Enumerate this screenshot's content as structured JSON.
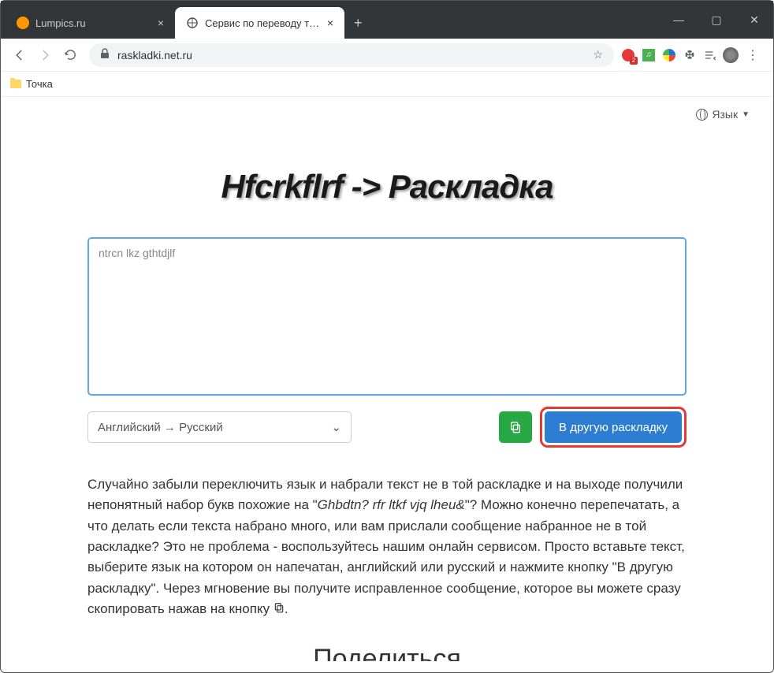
{
  "window": {
    "tabs": [
      {
        "title": "Lumpics.ru"
      },
      {
        "title": "Сервис по переводу текста в др"
      }
    ]
  },
  "toolbar": {
    "url": "raskladki.net.ru"
  },
  "bookmarks": {
    "item1": "Точка"
  },
  "header": {
    "lang_label": "Язык"
  },
  "page": {
    "title": "Hfcrkflrf -> Раскладка",
    "textarea_value": "ntrcn lkz gthtdjlf",
    "select_value": "Английский → Русский",
    "btn_main": "В другую раскладку",
    "desc_1": "Случайно забыли переключить язык и набрали текст не в той раскладке и на выходе получили непонятный набор букв похожие на \"",
    "desc_em": "Ghbdtn? rfr ltkf vjq lheu&",
    "desc_2": "\"? Можно конечно перепечатать, а что делать если текста набрано много, или вам прислали сообщение набранное не в той раскладке? Это не проблема - воспользуйтесь нашим онлайн сервисом. Просто вставьте текст, выберите язык на котором он напечатан, английский или русский и нажмите кнопку \"В другую раскладку\". Через мгновение вы получите исправленное сообщение, которое вы можете сразу скопировать нажав на кнопку ",
    "desc_3": ".",
    "share_title": "Поделиться"
  }
}
